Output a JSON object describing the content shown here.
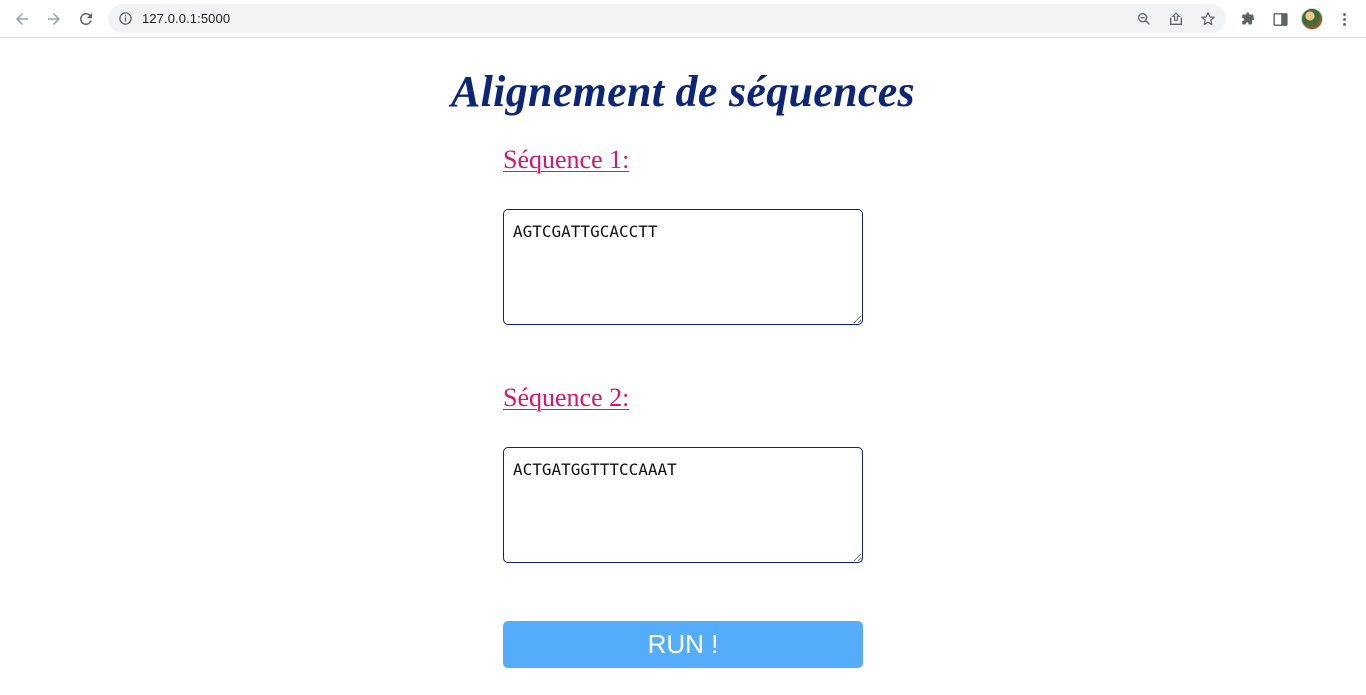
{
  "browser": {
    "url": "127.0.0.1:5000",
    "icons": [
      "back-arrow-icon",
      "forward-arrow-icon",
      "reload-icon",
      "info-icon",
      "zoom-icon",
      "share-icon",
      "bookmark-star-icon",
      "extensions-icon",
      "side-panel-icon",
      "avatar",
      "kebab-menu-icon"
    ]
  },
  "page": {
    "title": "Alignement de séquences",
    "sequence1": {
      "label": "Séquence 1:",
      "value": "AGTCGATTGCACCTT"
    },
    "sequence2": {
      "label": "Séquence 2:",
      "value": "ACTGATGGTTTCCAAAT"
    },
    "run_button": "RUN !"
  },
  "colors": {
    "title": "#0c2577",
    "label": "#d6156e",
    "button": "#55acfb",
    "textarea_border": "#0c2577"
  }
}
